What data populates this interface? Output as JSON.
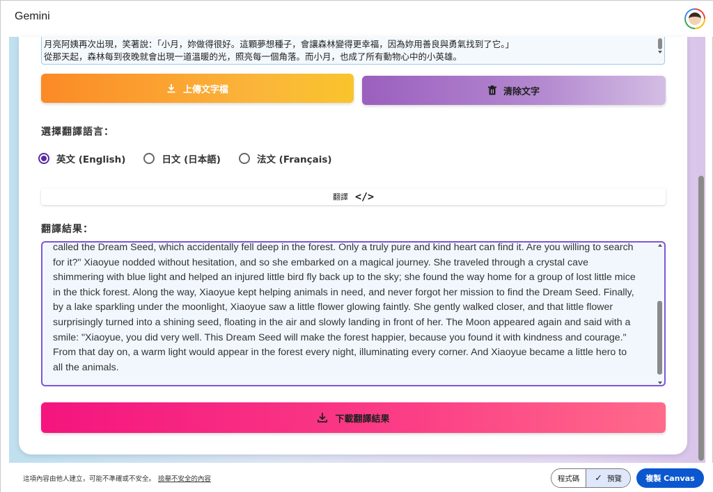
{
  "app": {
    "title": "Gemini"
  },
  "source": {
    "lines": [
      "月亮阿姨再次出現，笑著說：「小月，妳做得很好。這顆夢想種子，會讓森林變得更幸福，因為妳用善良與勇氣找到了它。」",
      "從那天起，森林每到夜晚就會出現一道溫暖的光，照亮每一個角落。而小月，也成了所有動物心中的小英雄。"
    ]
  },
  "buttons": {
    "upload": "上傳文字檔",
    "clear": "清除文字",
    "translate": "翻譯",
    "download": "下載翻譯結果"
  },
  "language": {
    "label": "選擇翻譯語言：",
    "options": [
      {
        "label": "英文 (English)",
        "checked": true
      },
      {
        "label": "日文 (日本語)",
        "checked": false
      },
      {
        "label": "法文 (Français)",
        "checked": false
      }
    ]
  },
  "result": {
    "label": "翻譯結果：",
    "lines": [
      "called the Dream Seed, which accidentally fell deep in the forest. Only a truly pure and kind heart can find it. Are you willing to search",
      "for it?\" Xiaoyue nodded without hesitation, and so she embarked on a magical journey. She traveled through a crystal cave",
      "shimmering with blue light and helped an injured little bird fly back up to the sky; she found the way home for a group of lost little mice",
      "in the thick forest. Along the way, Xiaoyue kept helping animals in need, and never forgot her mission to find the Dream Seed. Finally,",
      "by a lake sparkling under the moonlight, Xiaoyue saw a little flower glowing faintly. She gently walked closer, and that little flower",
      "surprisingly turned into a shining seed, floating in the air and slowly landing in front of her. The Moon appeared again and said with a",
      "smile: \"Xiaoyue, you did very well. This Dream Seed will make the forest happier, because you found it with kindness and courage.\"",
      "From that day on, a warm light would appear in the forest every night, illuminating every corner. And Xiaoyue became a little hero to",
      "all the animals."
    ]
  },
  "footer": {
    "disclaimer": "這項內容由他人建立，可能不準確或不安全。",
    "report": "撿舉不安全的內容",
    "code": "程式碼",
    "preview": "預覽",
    "copy": "複製 Canvas"
  },
  "colors": {
    "accent": "#5a2aa6",
    "upload_start": "#fb8a26",
    "clear_start": "#9b5fbe",
    "download_start": "#f4157e",
    "copy_button": "#0b57d0"
  },
  "icons": {
    "upload": "download-icon",
    "clear": "trash-icon",
    "translate": "code-icon",
    "download": "download-icon",
    "preview": "check-icon"
  }
}
